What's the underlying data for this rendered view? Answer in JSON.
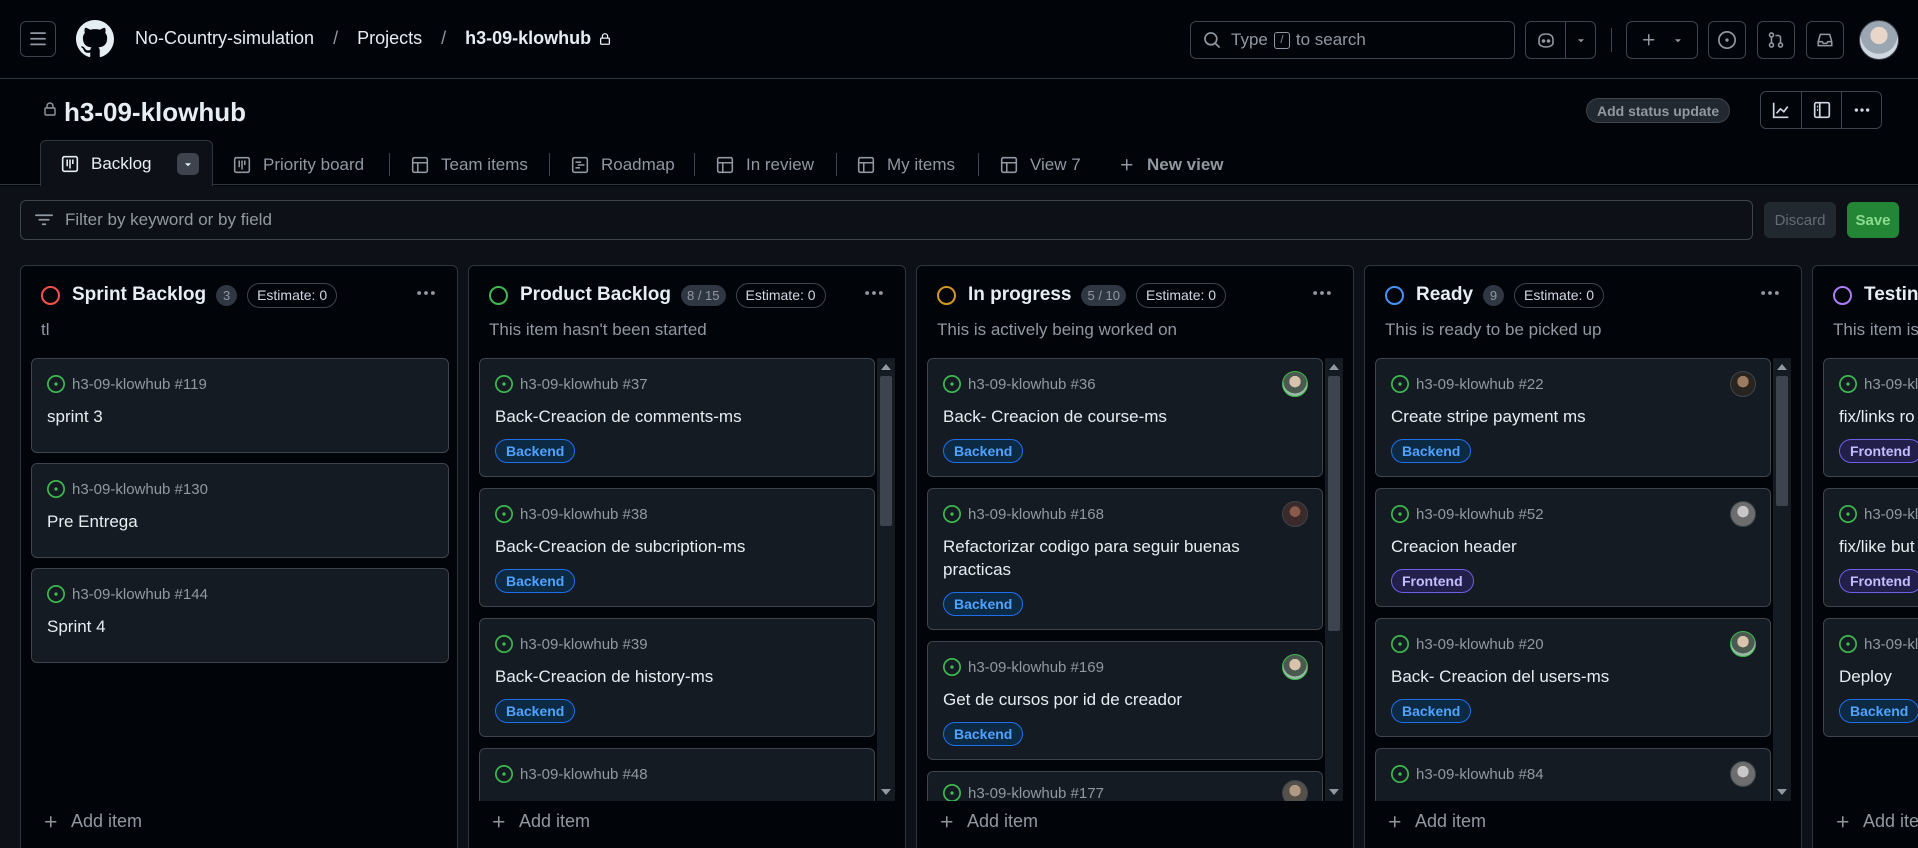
{
  "header": {
    "breadcrumbs": [
      "No-Country-simulation",
      "Projects",
      "h3-09-klowhub"
    ],
    "search_prefix": "Type",
    "search_key": "/",
    "search_suffix": "to search"
  },
  "project": {
    "title": "h3-09-klowhub",
    "status_button": "Add status update"
  },
  "tabs": [
    {
      "label": "Backlog",
      "icon": "board-icon",
      "active": true
    },
    {
      "label": "Priority board",
      "icon": "board-icon"
    },
    {
      "label": "Team items",
      "icon": "table-icon"
    },
    {
      "label": "Roadmap",
      "icon": "roadmap-icon"
    },
    {
      "label": "In review",
      "icon": "table-icon"
    },
    {
      "label": "My items",
      "icon": "table-icon"
    },
    {
      "label": "View 7",
      "icon": "table-icon"
    },
    {
      "label": "New view",
      "icon": "plus-icon"
    }
  ],
  "filter": {
    "placeholder": "Filter by keyword or by field",
    "discard": "Discard",
    "save": "Save"
  },
  "columns": [
    {
      "title": "Sprint Backlog",
      "count": "3",
      "estimate": "Estimate: 0",
      "description": "tl",
      "color": "#f85149",
      "cards": [
        {
          "ref": "h3-09-klowhub #119",
          "title": "sprint 3"
        },
        {
          "ref": "h3-09-klowhub #130",
          "title": "Pre Entrega"
        },
        {
          "ref": "h3-09-klowhub #144",
          "title": "Sprint 4"
        }
      ],
      "add_item": "Add item"
    },
    {
      "title": "Product Backlog",
      "count": "8 / 15",
      "estimate": "Estimate: 0",
      "description": "This item hasn't been started",
      "color": "#3fb950",
      "cards": [
        {
          "ref": "h3-09-klowhub #37",
          "title": "Back-Creacion de comments-ms",
          "label": "Backend"
        },
        {
          "ref": "h3-09-klowhub #38",
          "title": "Back-Creacion de subcription-ms",
          "label": "Backend"
        },
        {
          "ref": "h3-09-klowhub #39",
          "title": "Back-Creacion de history-ms",
          "label": "Backend"
        },
        {
          "ref": "h3-09-klowhub #48",
          "title": ""
        }
      ],
      "add_item": "Add item"
    },
    {
      "title": "In progress",
      "count": "5 / 10",
      "estimate": "Estimate: 0",
      "description": "This is actively being worked on",
      "color": "#d29922",
      "cards": [
        {
          "ref": "h3-09-klowhub #36",
          "title": "Back- Creacion de course-ms",
          "label": "Backend"
        },
        {
          "ref": "h3-09-klowhub #168",
          "title": "Refactorizar codigo para seguir buenas practicas",
          "label": "Backend"
        },
        {
          "ref": "h3-09-klowhub #169",
          "title": "Get de cursos por id de creador",
          "label": "Backend"
        },
        {
          "ref": "h3-09-klowhub #177",
          "title": ""
        }
      ],
      "add_item": "Add item"
    },
    {
      "title": "Ready",
      "count": "9",
      "estimate": "Estimate: 0",
      "description": "This is ready to be picked up",
      "color": "#4493f8",
      "cards": [
        {
          "ref": "h3-09-klowhub #22",
          "title": "Create stripe payment ms",
          "label": "Backend"
        },
        {
          "ref": "h3-09-klowhub #52",
          "title": "Creacion header",
          "label": "Frontend"
        },
        {
          "ref": "h3-09-klowhub #20",
          "title": "Back- Creacion del users-ms",
          "label": "Backend"
        },
        {
          "ref": "h3-09-klowhub #84",
          "title": ""
        }
      ],
      "add_item": "Add item"
    },
    {
      "title": "Testing",
      "count": "",
      "estimate": "",
      "description": "This item is",
      "color": "#ab7df8",
      "cards": [
        {
          "ref": "h3-09-kl",
          "title": "fix/links ro",
          "label": "Frontend"
        },
        {
          "ref": "h3-09-kl",
          "title": "fix/like but",
          "label": "Frontend"
        },
        {
          "ref": "h3-09-kl",
          "title": "Deploy",
          "label": "Backend"
        }
      ],
      "add_item": "Add ite"
    }
  ]
}
